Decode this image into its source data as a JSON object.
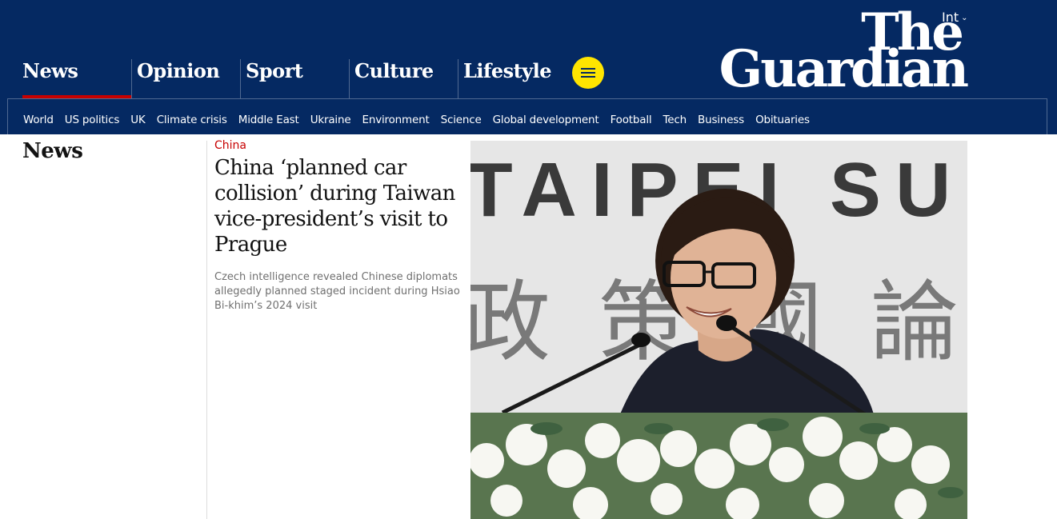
{
  "header": {
    "edition": "Int",
    "logo_line1": "The",
    "logo_line2": "Guardian",
    "pillars": [
      {
        "label": "News",
        "active": true
      },
      {
        "label": "Opinion"
      },
      {
        "label": "Sport"
      },
      {
        "label": "Culture"
      },
      {
        "label": "Lifestyle"
      }
    ],
    "menu_icon": "hamburger-icon",
    "subnav": [
      "World",
      "US politics",
      "UK",
      "Climate crisis",
      "Middle East",
      "Ukraine",
      "Environment",
      "Science",
      "Global development",
      "Football",
      "Tech",
      "Business",
      "Obituaries"
    ]
  },
  "colors": {
    "brand_blue": "#052962",
    "accent_red": "#c70000",
    "menu_yellow": "#ffe500"
  },
  "main": {
    "section_title": "News",
    "card": {
      "kicker": "China",
      "headline": "China ‘planned car collision’ during Taiwan vice-president’s visit to Prague",
      "standfirst": "Czech intelligence revealed Chinese diplomats allegedly planned staged incident during Hsiao Bi-khim’s 2024 visit"
    },
    "photo": {
      "backdrop_latin": "TAIPEI SU",
      "backdrop_cjk": "政策國論峰"
    }
  }
}
